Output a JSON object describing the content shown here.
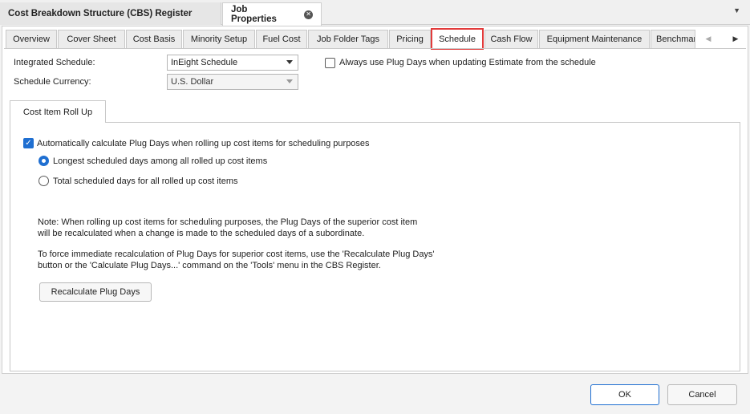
{
  "doc_tabs": [
    {
      "label": "Cost Breakdown Structure (CBS) Register"
    },
    {
      "label": "Job Properties"
    }
  ],
  "prop_tabs": [
    {
      "label": "Overview"
    },
    {
      "label": "Cover Sheet"
    },
    {
      "label": "Cost Basis"
    },
    {
      "label": "Minority Setup"
    },
    {
      "label": "Fuel Cost"
    },
    {
      "label": "Job Folder Tags"
    },
    {
      "label": "Pricing"
    },
    {
      "label": "Schedule"
    },
    {
      "label": "Cash Flow"
    },
    {
      "label": "Equipment Maintenance"
    },
    {
      "label": "Benchmar"
    }
  ],
  "selected_tab": "Schedule",
  "accent_color": "#1f6fd1",
  "highlight_color": "#e23b3b",
  "form": {
    "integrated_schedule_label": "Integrated Schedule:",
    "integrated_schedule_value": "InEight Schedule",
    "schedule_currency_label": "Schedule Currency:",
    "schedule_currency_value": "U.S. Dollar",
    "always_plug_days_label": "Always use Plug Days when updating Estimate from the schedule",
    "always_plug_days_checked": false
  },
  "rollup": {
    "group_tab_label": "Cost Item Roll Up",
    "auto_calc_label": "Automatically calculate Plug Days when rolling up cost items for scheduling purposes",
    "auto_calc_checked": true,
    "option_longest": "Longest scheduled days among all rolled up cost items",
    "option_total": "Total scheduled days for all rolled up cost items",
    "selected_option": "longest",
    "note_line1": "Note:  When rolling up cost items for scheduling purposes, the Plug Days of the superior cost item",
    "note_line2": "will be recalculated when a change is made to the scheduled days of a subordinate.",
    "note_line3": "To force immediate recalculation of Plug Days for superior cost items, use the 'Recalculate Plug Days'",
    "note_line4": "button or the 'Calculate Plug Days...' command on the 'Tools' menu in the CBS Register.",
    "recalc_button": "Recalculate Plug Days"
  },
  "footer": {
    "ok_label": "OK",
    "cancel_label": "Cancel"
  }
}
